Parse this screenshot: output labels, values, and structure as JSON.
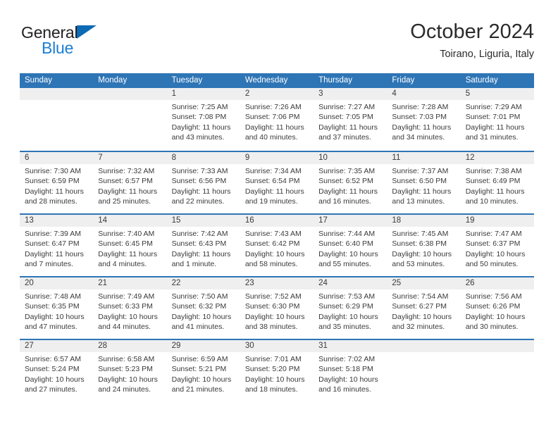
{
  "brand": {
    "name_part1": "General",
    "name_part2": "Blue",
    "colors": {
      "general_text": "#231f20",
      "blue_text": "#1b7fd4",
      "triangle": "#0d6ab5"
    }
  },
  "header": {
    "title": "October 2024",
    "subtitle": "Toirano, Liguria, Italy"
  },
  "theme": {
    "header_bar": "#2e75b6",
    "daynum_band": "#efefef",
    "week_separator": "#2e75b6",
    "text": "#3a3a3a"
  },
  "weekdays": [
    "Sunday",
    "Monday",
    "Tuesday",
    "Wednesday",
    "Thursday",
    "Friday",
    "Saturday"
  ],
  "weeks": [
    [
      {
        "day": "",
        "lines": []
      },
      {
        "day": "",
        "lines": []
      },
      {
        "day": "1",
        "lines": [
          "Sunrise: 7:25 AM",
          "Sunset: 7:08 PM",
          "Daylight: 11 hours",
          "and 43 minutes."
        ]
      },
      {
        "day": "2",
        "lines": [
          "Sunrise: 7:26 AM",
          "Sunset: 7:06 PM",
          "Daylight: 11 hours",
          "and 40 minutes."
        ]
      },
      {
        "day": "3",
        "lines": [
          "Sunrise: 7:27 AM",
          "Sunset: 7:05 PM",
          "Daylight: 11 hours",
          "and 37 minutes."
        ]
      },
      {
        "day": "4",
        "lines": [
          "Sunrise: 7:28 AM",
          "Sunset: 7:03 PM",
          "Daylight: 11 hours",
          "and 34 minutes."
        ]
      },
      {
        "day": "5",
        "lines": [
          "Sunrise: 7:29 AM",
          "Sunset: 7:01 PM",
          "Daylight: 11 hours",
          "and 31 minutes."
        ]
      }
    ],
    [
      {
        "day": "6",
        "lines": [
          "Sunrise: 7:30 AM",
          "Sunset: 6:59 PM",
          "Daylight: 11 hours",
          "and 28 minutes."
        ]
      },
      {
        "day": "7",
        "lines": [
          "Sunrise: 7:32 AM",
          "Sunset: 6:57 PM",
          "Daylight: 11 hours",
          "and 25 minutes."
        ]
      },
      {
        "day": "8",
        "lines": [
          "Sunrise: 7:33 AM",
          "Sunset: 6:56 PM",
          "Daylight: 11 hours",
          "and 22 minutes."
        ]
      },
      {
        "day": "9",
        "lines": [
          "Sunrise: 7:34 AM",
          "Sunset: 6:54 PM",
          "Daylight: 11 hours",
          "and 19 minutes."
        ]
      },
      {
        "day": "10",
        "lines": [
          "Sunrise: 7:35 AM",
          "Sunset: 6:52 PM",
          "Daylight: 11 hours",
          "and 16 minutes."
        ]
      },
      {
        "day": "11",
        "lines": [
          "Sunrise: 7:37 AM",
          "Sunset: 6:50 PM",
          "Daylight: 11 hours",
          "and 13 minutes."
        ]
      },
      {
        "day": "12",
        "lines": [
          "Sunrise: 7:38 AM",
          "Sunset: 6:49 PM",
          "Daylight: 11 hours",
          "and 10 minutes."
        ]
      }
    ],
    [
      {
        "day": "13",
        "lines": [
          "Sunrise: 7:39 AM",
          "Sunset: 6:47 PM",
          "Daylight: 11 hours",
          "and 7 minutes."
        ]
      },
      {
        "day": "14",
        "lines": [
          "Sunrise: 7:40 AM",
          "Sunset: 6:45 PM",
          "Daylight: 11 hours",
          "and 4 minutes."
        ]
      },
      {
        "day": "15",
        "lines": [
          "Sunrise: 7:42 AM",
          "Sunset: 6:43 PM",
          "Daylight: 11 hours",
          "and 1 minute."
        ]
      },
      {
        "day": "16",
        "lines": [
          "Sunrise: 7:43 AM",
          "Sunset: 6:42 PM",
          "Daylight: 10 hours",
          "and 58 minutes."
        ]
      },
      {
        "day": "17",
        "lines": [
          "Sunrise: 7:44 AM",
          "Sunset: 6:40 PM",
          "Daylight: 10 hours",
          "and 55 minutes."
        ]
      },
      {
        "day": "18",
        "lines": [
          "Sunrise: 7:45 AM",
          "Sunset: 6:38 PM",
          "Daylight: 10 hours",
          "and 53 minutes."
        ]
      },
      {
        "day": "19",
        "lines": [
          "Sunrise: 7:47 AM",
          "Sunset: 6:37 PM",
          "Daylight: 10 hours",
          "and 50 minutes."
        ]
      }
    ],
    [
      {
        "day": "20",
        "lines": [
          "Sunrise: 7:48 AM",
          "Sunset: 6:35 PM",
          "Daylight: 10 hours",
          "and 47 minutes."
        ]
      },
      {
        "day": "21",
        "lines": [
          "Sunrise: 7:49 AM",
          "Sunset: 6:33 PM",
          "Daylight: 10 hours",
          "and 44 minutes."
        ]
      },
      {
        "day": "22",
        "lines": [
          "Sunrise: 7:50 AM",
          "Sunset: 6:32 PM",
          "Daylight: 10 hours",
          "and 41 minutes."
        ]
      },
      {
        "day": "23",
        "lines": [
          "Sunrise: 7:52 AM",
          "Sunset: 6:30 PM",
          "Daylight: 10 hours",
          "and 38 minutes."
        ]
      },
      {
        "day": "24",
        "lines": [
          "Sunrise: 7:53 AM",
          "Sunset: 6:29 PM",
          "Daylight: 10 hours",
          "and 35 minutes."
        ]
      },
      {
        "day": "25",
        "lines": [
          "Sunrise: 7:54 AM",
          "Sunset: 6:27 PM",
          "Daylight: 10 hours",
          "and 32 minutes."
        ]
      },
      {
        "day": "26",
        "lines": [
          "Sunrise: 7:56 AM",
          "Sunset: 6:26 PM",
          "Daylight: 10 hours",
          "and 30 minutes."
        ]
      }
    ],
    [
      {
        "day": "27",
        "lines": [
          "Sunrise: 6:57 AM",
          "Sunset: 5:24 PM",
          "Daylight: 10 hours",
          "and 27 minutes."
        ]
      },
      {
        "day": "28",
        "lines": [
          "Sunrise: 6:58 AM",
          "Sunset: 5:23 PM",
          "Daylight: 10 hours",
          "and 24 minutes."
        ]
      },
      {
        "day": "29",
        "lines": [
          "Sunrise: 6:59 AM",
          "Sunset: 5:21 PM",
          "Daylight: 10 hours",
          "and 21 minutes."
        ]
      },
      {
        "day": "30",
        "lines": [
          "Sunrise: 7:01 AM",
          "Sunset: 5:20 PM",
          "Daylight: 10 hours",
          "and 18 minutes."
        ]
      },
      {
        "day": "31",
        "lines": [
          "Sunrise: 7:02 AM",
          "Sunset: 5:18 PM",
          "Daylight: 10 hours",
          "and 16 minutes."
        ]
      },
      {
        "day": "",
        "lines": []
      },
      {
        "day": "",
        "lines": []
      }
    ]
  ]
}
